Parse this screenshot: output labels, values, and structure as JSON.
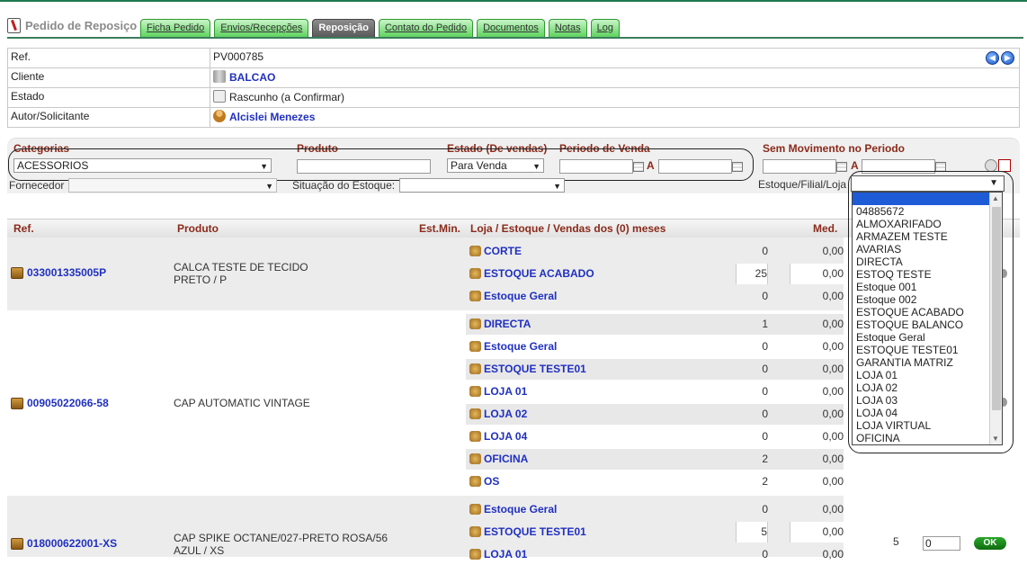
{
  "window_title": "Pedido de Reposiço",
  "tabs": [
    "Ficha Pedido",
    "Envios/Recepções",
    "Reposição",
    "Contato do Pedido",
    "Documentos",
    "Notas",
    "Log"
  ],
  "active_tab": "Reposição",
  "header": {
    "ref_label": "Ref.",
    "ref_value": "PV000785",
    "cliente_label": "Cliente",
    "cliente_value": "BALCAO",
    "estado_label": "Estado",
    "estado_value": "Rascunho (a Confirmar)",
    "autor_label": "Autor/Solicitante",
    "autor_value": "Alcislei Menezes"
  },
  "filters": {
    "categorias_label": "Categorias",
    "categorias_value": "ACESSORIOS",
    "produto_label": "Produto",
    "produto_value": "",
    "estado_label": "Estado (De vendas)",
    "estado_value": "Para Venda",
    "periodo_label": "Periodo de Venda",
    "a_label": "A",
    "sem_mov_label": "Sem Movimento no Periodo",
    "a2_label": "A",
    "fornecedor_label": "Fornecedor",
    "situacao_label": "Situação do Estoque:",
    "estoque_label": "Estoque/Filial/Loja"
  },
  "columns": {
    "ref": "Ref.",
    "produto": "Produto",
    "est_min": "Est.Min.",
    "loja": "Loja / Estoque / Vendas dos (0) meses",
    "med": "Med."
  },
  "groups": [
    {
      "ref": "033001335005P",
      "produto_line1": "CALCA TESTE DE TECIDO",
      "produto_line2": "PRETO / P",
      "stores": [
        {
          "name": "CORTE",
          "qty": "0",
          "val": "0,00"
        },
        {
          "name": "ESTOQUE ACABADO",
          "qty": "25",
          "val": "0,00"
        },
        {
          "name": "Estoque Geral",
          "qty": "0",
          "val": "0,00"
        }
      ]
    },
    {
      "ref": "00905022066-58",
      "produto_line1": "CAP AUTOMATIC VINTAGE",
      "produto_line2": "",
      "stores": [
        {
          "name": "DIRECTA",
          "qty": "1",
          "val": "0,00"
        },
        {
          "name": "Estoque Geral",
          "qty": "0",
          "val": "0,00"
        },
        {
          "name": "ESTOQUE TESTE01",
          "qty": "0",
          "val": "0,00"
        },
        {
          "name": "LOJA 01",
          "qty": "0",
          "val": "0,00"
        },
        {
          "name": "LOJA 02",
          "qty": "0",
          "val": "0,00"
        },
        {
          "name": "LOJA 04",
          "qty": "0",
          "val": "0,00"
        },
        {
          "name": "OFICINA",
          "qty": "2",
          "val": "0,00"
        },
        {
          "name": "OS",
          "qty": "2",
          "val": "0,00"
        }
      ]
    },
    {
      "ref": "018000622001-XS",
      "produto_line1": "CAP SPIKE OCTANE/027-PRETO ROSA/56",
      "produto_line2": "AZUL / XS",
      "stores": [
        {
          "name": "Estoque Geral",
          "qty": "0",
          "val": "0,00"
        },
        {
          "name": "ESTOQUE TESTE01",
          "qty": "5",
          "val": "0,00"
        },
        {
          "name": "LOJA 01",
          "qty": "0",
          "val": "0,00"
        }
      ],
      "med": "5",
      "input_value": "0",
      "ok_label": "OK"
    }
  ],
  "dropdown_options": [
    "",
    "04885672",
    "ALMOXARIFADO",
    "ARMAZEM TESTE",
    "AVARIAS",
    "DIRECTA",
    "ESTOQ TESTE",
    "Estoque 001",
    "Estoque 002",
    "ESTOQUE ACABADO",
    "ESTOQUE BALANCO",
    "Estoque Geral",
    "ESTOQUE TESTE01",
    "GARANTIA MATRIZ",
    "LOJA 01",
    "LOJA 02",
    "LOJA 03",
    "LOJA 04",
    "LOJA VIRTUAL",
    "OFICINA"
  ]
}
